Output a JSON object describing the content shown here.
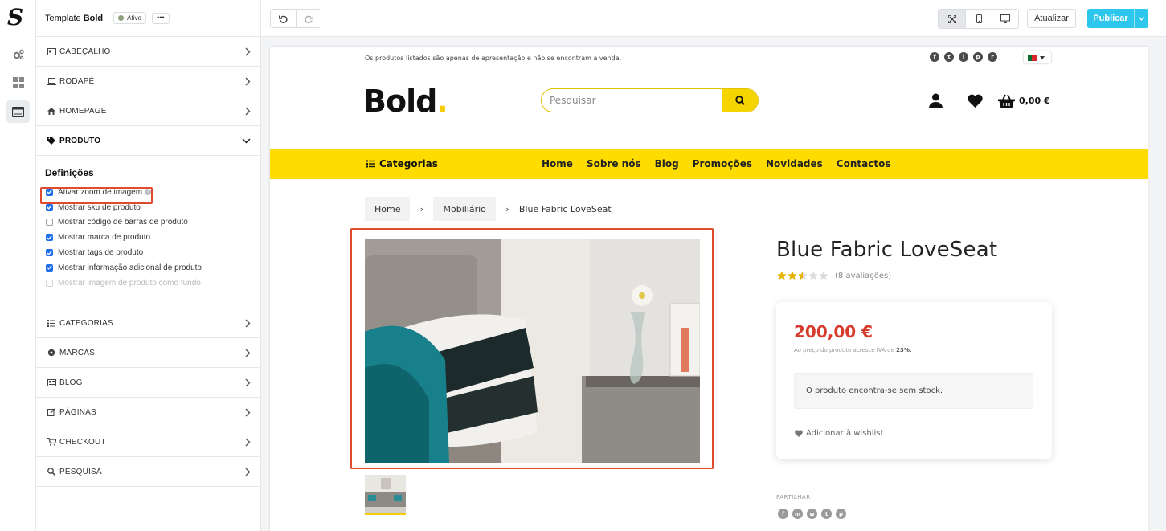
{
  "app": {
    "logo": "S",
    "template_label": "Template",
    "template_name": "Bold",
    "status": "Ativo",
    "more": "•••"
  },
  "sections_top": [
    {
      "label": "CABEÇALHO",
      "icon": "id-card-icon"
    },
    {
      "label": "RODAPÉ",
      "icon": "laptop-icon"
    },
    {
      "label": "HOMEPAGE",
      "icon": "home-icon"
    },
    {
      "label": "PRODUTO",
      "icon": "tag-icon"
    }
  ],
  "definitions": {
    "title": "Definições",
    "options": [
      {
        "label": "Ativar zoom de imagem",
        "checked": true,
        "help": "?"
      },
      {
        "label": "Mostrar sku de produto",
        "checked": true
      },
      {
        "label": "Mostrar código de barras de produto",
        "checked": false
      },
      {
        "label": "Mostrar marca de produto",
        "checked": true
      },
      {
        "label": "Mostrar tags de produto",
        "checked": true
      },
      {
        "label": "Mostrar informação adicional de produto",
        "checked": true
      },
      {
        "label": "Mostrar imagem de produto como fundo",
        "checked": false,
        "disabled": true
      }
    ]
  },
  "sections_bottom": [
    {
      "label": "CATEGORIAS",
      "icon": "list-icon"
    },
    {
      "label": "MARCAS",
      "icon": "certificate-icon"
    },
    {
      "label": "BLOG",
      "icon": "newspaper-icon"
    },
    {
      "label": "PÁGINAS",
      "icon": "edit-icon"
    },
    {
      "label": "CHECKOUT",
      "icon": "cart-icon"
    },
    {
      "label": "PESQUISA",
      "icon": "search-icon"
    }
  ],
  "toolbar": {
    "update_label": "Atualizar",
    "publish_label": "Publicar"
  },
  "store": {
    "notice": "Os produtos listados são apenas de apresentação e não se encontram à venda.",
    "social": [
      "f",
      "t",
      "i",
      "p",
      "r"
    ],
    "brand": "Bold",
    "brand_dot": ".",
    "search_placeholder": "Pesquisar",
    "cart_total": "0,00 €",
    "categories_label": "Categorias",
    "nav": [
      "Home",
      "Sobre nós",
      "Blog",
      "Promoções",
      "Novidades",
      "Contactos"
    ],
    "breadcrumb": [
      "Home",
      "Mobiliário",
      "Blue Fabric LoveSeat"
    ],
    "breadcrumb_sep": "›",
    "product": {
      "title": "Blue Fabric LoveSeat",
      "rating": 2.5,
      "rating_max": 5,
      "reviews": "(8 avaliações)",
      "price": "200,00 €",
      "vat_text": "Ao preço do produto acresce IVA de",
      "vat_value": "23%.",
      "stock_text": "O produto encontra-se sem stock.",
      "wishlist": "Adicionar à wishlist",
      "share_label": "PARTILHAR",
      "share": [
        "f",
        "m",
        "w",
        "t",
        "p"
      ]
    }
  },
  "colors": {
    "accent": "#ffdc00",
    "publish": "#2dc6ec",
    "price": "#d63c2e",
    "highlight": "#e04b2f",
    "checkbox": "#1f6feb"
  }
}
